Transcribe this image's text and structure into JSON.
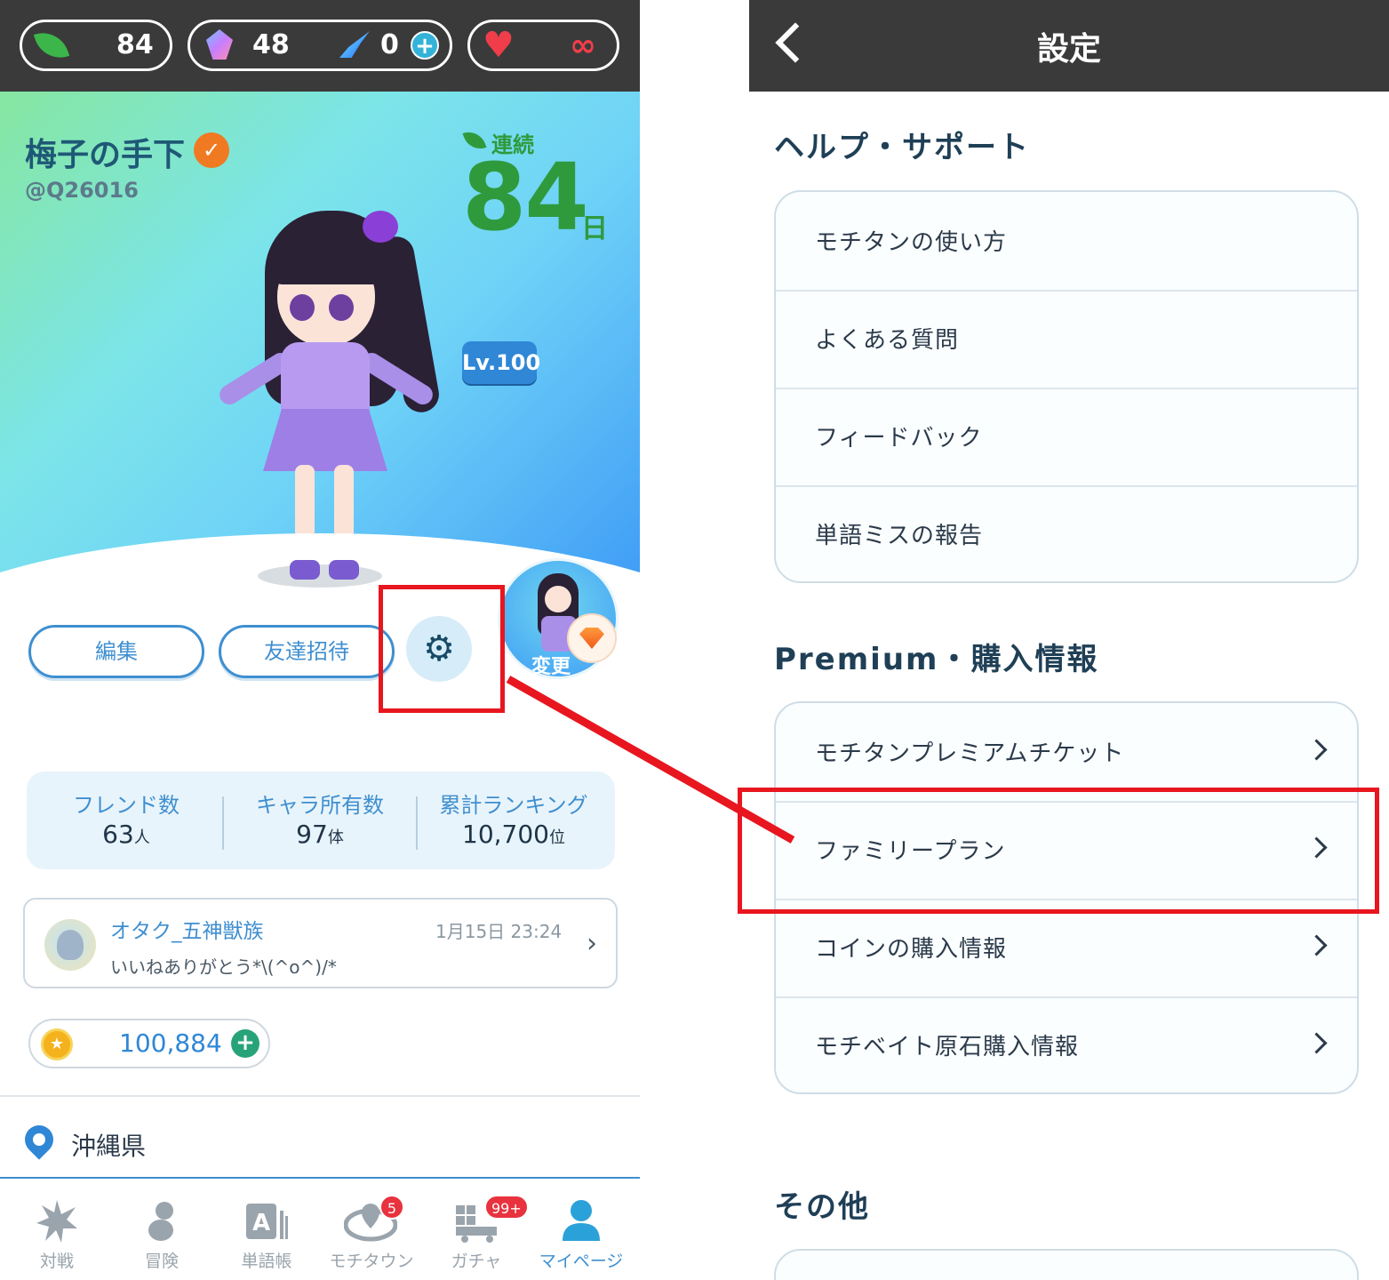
{
  "left": {
    "currency": {
      "leaves": "84",
      "gems": "48",
      "crystals": "0",
      "hearts": "∞"
    },
    "profile": {
      "username": "梅子の手下",
      "user_id": "@Q26016",
      "streak_label": "連続",
      "streak_days": "84",
      "streak_unit": "日",
      "level": "Lv.100",
      "avatar_change_label": "変更"
    },
    "buttons": {
      "edit": "編集",
      "invite": "友達招待"
    },
    "stats": [
      {
        "label": "フレンド数",
        "value": "63",
        "unit": "人"
      },
      {
        "label": "キャラ所有数",
        "value": "97",
        "unit": "体"
      },
      {
        "label": "累計ランキング",
        "value": "10,700",
        "unit": "位"
      }
    ],
    "notification": {
      "name": "オタク_五神獣族",
      "time": "1月15日 23:24",
      "message": "いいねありがとう*\\(^o^)/*"
    },
    "coins": "100,884",
    "prefecture": "沖縄県",
    "tabs": [
      {
        "label": "対戦",
        "icon": "battle-icon"
      },
      {
        "label": "冒険",
        "icon": "adventure-icon"
      },
      {
        "label": "単語帳",
        "icon": "wordbook-icon"
      },
      {
        "label": "モチタウン",
        "icon": "town-icon",
        "badge": "5"
      },
      {
        "label": "ガチャ",
        "icon": "gacha-icon",
        "badge": "99+"
      },
      {
        "label": "マイページ",
        "icon": "mypage-icon",
        "active": true
      }
    ]
  },
  "right": {
    "title": "設定",
    "sections": [
      {
        "title": "ヘルプ・サポート",
        "items": [
          "モチタンの使い方",
          "よくある質問",
          "フィードバック",
          "単語ミスの報告"
        ]
      },
      {
        "title": "Premium・購入情報",
        "items": [
          "モチタンプレミアムチケット",
          "ファミリープラン",
          "コインの購入情報",
          "モチベイト原石購入情報"
        ]
      },
      {
        "title": "その他",
        "items": []
      }
    ]
  },
  "colors": {
    "accent": "#3f8fd0",
    "streak": "#2f9a3c",
    "highlight": "#e8161f",
    "header": "#3a3a3a"
  }
}
